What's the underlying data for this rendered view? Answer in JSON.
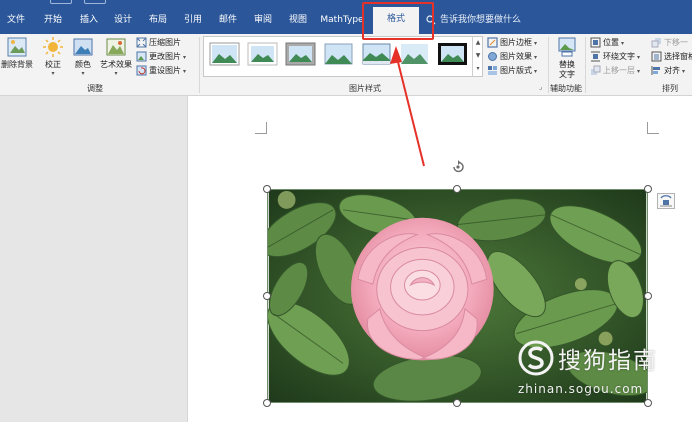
{
  "tabs": [
    {
      "label": "文件"
    },
    {
      "label": "开始"
    },
    {
      "label": "插入"
    },
    {
      "label": "设计"
    },
    {
      "label": "布局"
    },
    {
      "label": "引用"
    },
    {
      "label": "邮件"
    },
    {
      "label": "审阅"
    },
    {
      "label": "视图"
    },
    {
      "label": "MathType"
    },
    {
      "label": "格式",
      "active": true
    }
  ],
  "tell_me": "告诉我你想要做什么",
  "ribbon": {
    "remove_bg": "删除背景",
    "corrections": "校正",
    "color": "颜色",
    "artistic": "艺术效果",
    "compress": "压缩图片",
    "change_picture": "更改图片",
    "reset_picture": "重设图片",
    "group_adjust": "调整",
    "group_styles": "图片样式",
    "picture_border": "图片边框",
    "picture_effects": "图片效果",
    "picture_layout": "图片版式",
    "alt_text": "替换文字",
    "group_accessibility": "辅助功能",
    "position": "位置",
    "wrap_text": "环绕文字",
    "bring_forward": "上移一层",
    "send_backward": "下移一",
    "selection_pane": "选择窗格",
    "align": "对齐",
    "group_arrange": "排列"
  },
  "watermark": {
    "brand": "搜狗指南",
    "url": "zhinan.sogou.com"
  },
  "colors": {
    "tab_bar": "#2b579a",
    "ribbon": "#f3f3f3",
    "highlight": "#e63129"
  }
}
